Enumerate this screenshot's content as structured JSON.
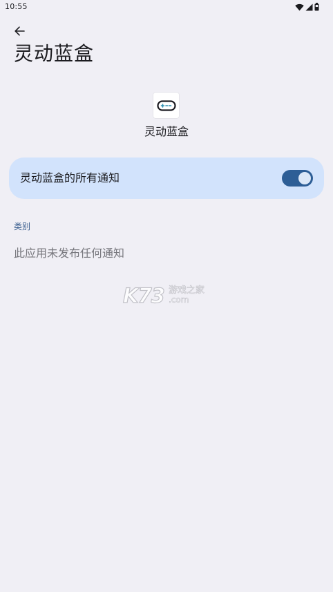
{
  "status_bar": {
    "time": "10:55",
    "icons": [
      "wifi-icon",
      "signal-icon",
      "battery-icon"
    ]
  },
  "header": {
    "back_icon": "arrow-back-icon",
    "title": "灵动蓝盒"
  },
  "app": {
    "icon": "gamepad-icon",
    "name": "灵动蓝盒"
  },
  "all_notifications": {
    "label": "灵动蓝盒的所有通知",
    "enabled": true
  },
  "categories": {
    "header": "类别",
    "empty_text": "此应用未发布任何通知"
  },
  "watermark": {
    "logo": "K73",
    "site_cn": "游戏之家",
    "domain": ".com"
  },
  "colors": {
    "background": "#f0eff5",
    "card": "#d2e3fc",
    "switch_on": "#2d5e96",
    "section_header": "#3b5f8f"
  }
}
